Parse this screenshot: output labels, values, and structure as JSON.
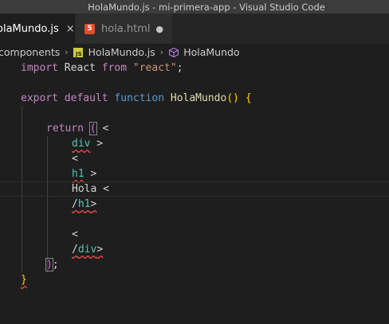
{
  "window": {
    "title": "HolaMundo.js - mi-primera-app - Visual Studio Code"
  },
  "tabs": [
    {
      "label": "olaMundo.js",
      "close_icon": "×",
      "active": true
    },
    {
      "label": "hola.html",
      "icon_text": "5",
      "dirty_icon": "●",
      "active": false
    }
  ],
  "breadcrumb": {
    "folder": "components",
    "file": "HolaMundo.js",
    "js_icon_text": "JS",
    "symbol": "HolaMundo",
    "separator": "›"
  },
  "code": {
    "l1": {
      "kw": "import",
      "name": " React ",
      "kw2": "from",
      "str": "\"react\"",
      "end": ";"
    },
    "l3": {
      "kw": "export",
      "kw2": "default",
      "kw3": "function",
      "fn": "HolaMundo",
      "parens": "()",
      "brace": "{"
    },
    "l5": {
      "kw": "return",
      "paren": "(",
      "lt": "<"
    },
    "l6": {
      "tag": "div",
      "gt": " >"
    },
    "l7": {
      "lt": "<"
    },
    "l8": {
      "tag": "h1",
      "gt": " >"
    },
    "l9": {
      "text": "Hola ",
      "lt": "<"
    },
    "l10": {
      "slash": "/",
      "tag": "h1",
      "gt": ">"
    },
    "l12": {
      "lt": "<"
    },
    "l13": {
      "slash": "/",
      "tag": "div",
      "gt": ">"
    },
    "l14": {
      "paren": ")",
      "semi": ";"
    },
    "l15": {
      "brace": "}"
    }
  }
}
